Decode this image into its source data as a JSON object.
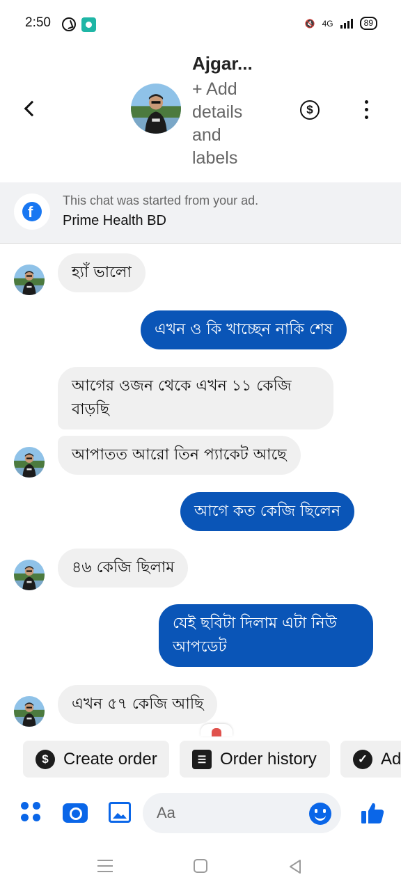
{
  "status_bar": {
    "time": "2:50",
    "network": "4G",
    "battery": "89"
  },
  "header": {
    "contact_name": "Ajgar...",
    "add_details": "+ Add details and labels"
  },
  "ad_banner": {
    "line1": "This chat was started from your ad.",
    "page_name": "Prime Health BD"
  },
  "messages": [
    {
      "direction": "in",
      "text": "হ্যাঁ ভালো"
    },
    {
      "direction": "out",
      "text": "এখন ও কি খাচ্ছেন নাকি শেষ"
    },
    {
      "direction": "in",
      "text": "আগের ওজন থেকে এখন ১১ কেজি বাড়ছি"
    },
    {
      "direction": "in",
      "text": "আপাতত আরো তিন প্যাকেট আছে"
    },
    {
      "direction": "out",
      "text": "আগে কত কেজি ছিলেন"
    },
    {
      "direction": "in",
      "text": "৪৬ কেজি ছিলাম"
    },
    {
      "direction": "out",
      "text": "যেই ছবিটা দিলাম এটা নিউ আপডেট"
    },
    {
      "direction": "in",
      "text": "এখন ৫৭ কেজি আছি"
    }
  ],
  "chips": {
    "create_order": "Create order",
    "order_history": "Order history",
    "third": "Ad"
  },
  "composer": {
    "placeholder": "Aa"
  },
  "colors": {
    "outgoing_bubble": "#0a55b7",
    "incoming_bubble": "#f0f0f0",
    "accent": "#0a66e8"
  }
}
